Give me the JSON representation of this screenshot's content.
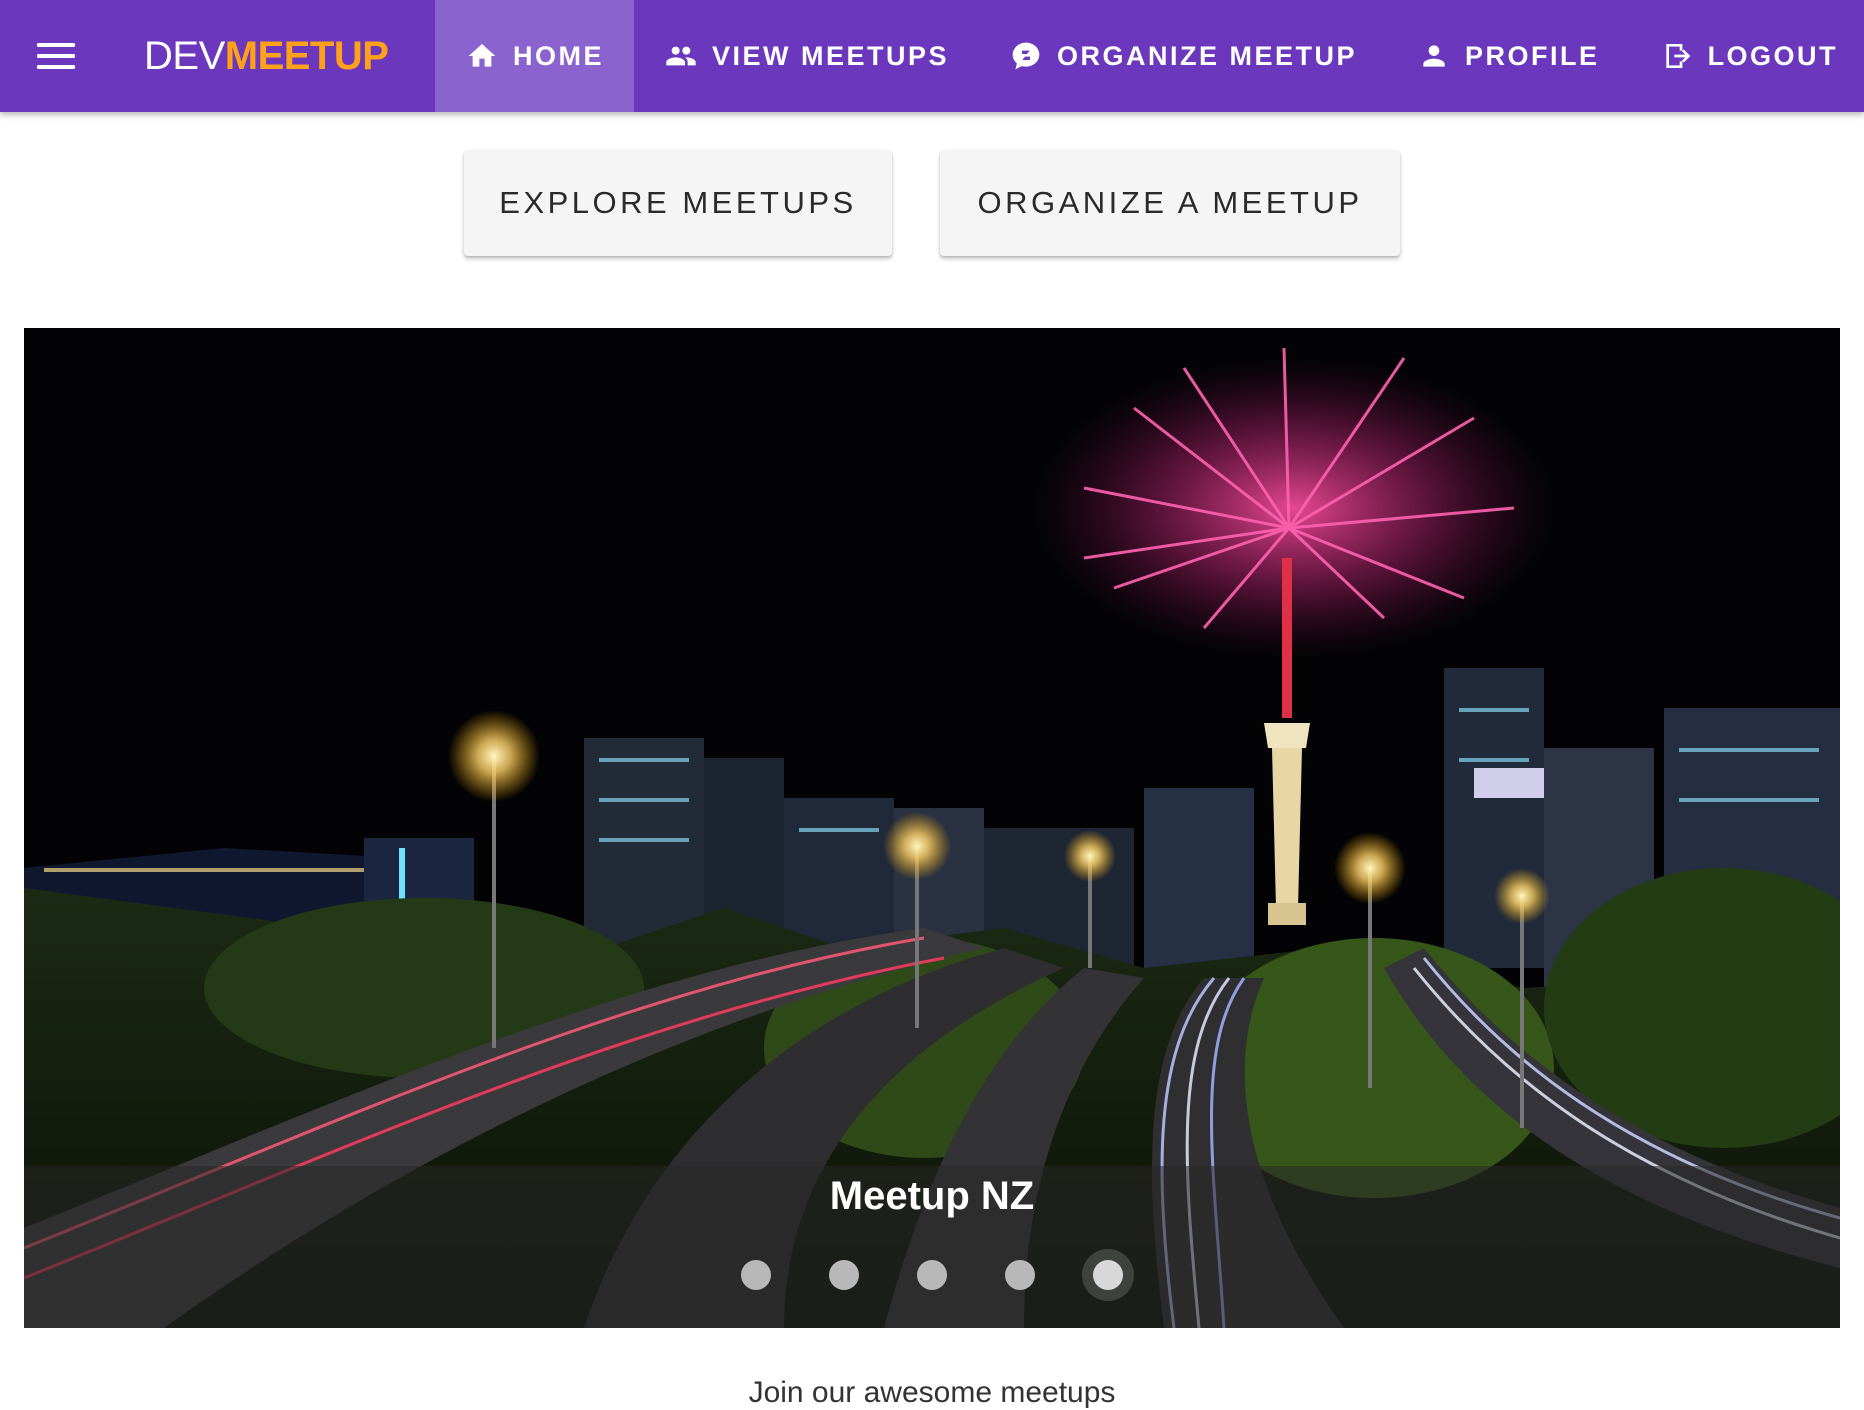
{
  "toolbar": {
    "brand_part1": "DEV",
    "brand_part2": "MEETUP",
    "nav": [
      {
        "label": "HOME",
        "icon": "home-icon",
        "active": true
      },
      {
        "label": "VIEW MEETUPS",
        "icon": "people-icon",
        "active": false
      },
      {
        "label": "ORGANIZE MEETUP",
        "icon": "chat-bubble-icon",
        "active": false
      },
      {
        "label": "PROFILE",
        "icon": "person-icon",
        "active": false
      },
      {
        "label": "LOGOUT",
        "icon": "logout-icon",
        "active": false
      }
    ]
  },
  "actions": {
    "explore_label": "EXPLORE MEETUPS",
    "organize_label": "ORGANIZE A MEETUP"
  },
  "carousel": {
    "caption": "Meetup NZ",
    "slide_count": 5,
    "active_index": 4
  },
  "footer": {
    "tagline": "Join our awesome meetups"
  },
  "colors": {
    "primary": "#6a37bd",
    "active_tab": "#8b63cf",
    "accent": "#ffa21a"
  }
}
